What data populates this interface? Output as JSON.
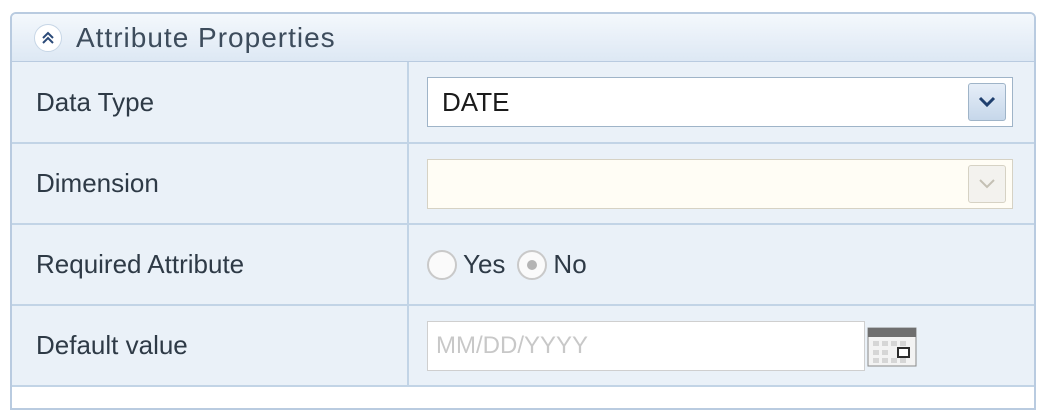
{
  "panel": {
    "title": "Attribute Properties",
    "collapse_icon": "double-chevron-up-icon"
  },
  "rows": {
    "data_type": {
      "label": "Data Type",
      "value": "DATE",
      "enabled": true
    },
    "dimension": {
      "label": "Dimension",
      "value": "",
      "enabled": false
    },
    "required_attribute": {
      "label": "Required Attribute",
      "options": [
        "Yes",
        "No"
      ],
      "selected": "No",
      "enabled": false
    },
    "default_value": {
      "label": "Default value",
      "value": "",
      "placeholder": "MM/DD/YYYY",
      "icon": "calendar-icon"
    }
  },
  "colors": {
    "accent": "#b9cbe0",
    "row_bg": "#eaf1f8",
    "label_text": "#2e3a46"
  }
}
